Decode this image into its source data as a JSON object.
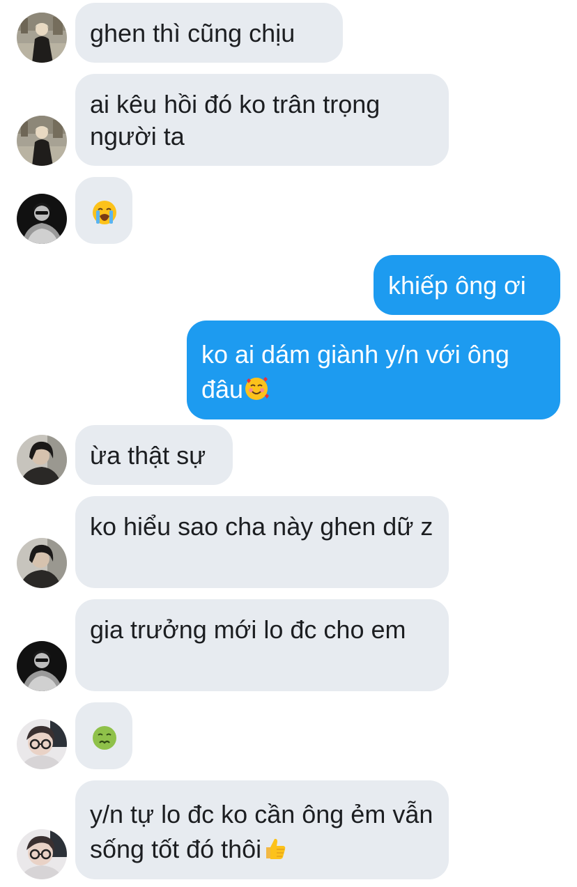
{
  "messages": [
    {
      "id": "m1",
      "direction": "incoming",
      "sender_avatar": "avatar-blond-coat",
      "text": "ghen thì cũng chịu",
      "emoji": ""
    },
    {
      "id": "m2",
      "direction": "incoming",
      "sender_avatar": "avatar-blond-coat",
      "text": "ai kêu hồi đó ko trân trọng người ta",
      "emoji": ""
    },
    {
      "id": "m3",
      "direction": "incoming",
      "sender_avatar": "avatar-bw-sunglasses",
      "text": "",
      "emoji": "loudly-crying-face"
    },
    {
      "id": "m4",
      "direction": "outgoing",
      "text": "khiếp ông ơi",
      "emoji": ""
    },
    {
      "id": "m5",
      "direction": "outgoing",
      "text": "ko ai dám giành y/n với ông đâu",
      "emoji": "smiling-face-with-hearts"
    },
    {
      "id": "m6",
      "direction": "incoming",
      "sender_avatar": "avatar-dark-hair",
      "text": "ừa thật sự",
      "emoji": ""
    },
    {
      "id": "m7",
      "direction": "incoming",
      "sender_avatar": "avatar-dark-hair",
      "text": "ko hiểu sao cha này ghen dữ z",
      "emoji": ""
    },
    {
      "id": "m8",
      "direction": "incoming",
      "sender_avatar": "avatar-bw-sunglasses",
      "text": "gia trưởng mới lo đc cho em",
      "emoji": ""
    },
    {
      "id": "m9",
      "direction": "incoming",
      "sender_avatar": "avatar-glasses",
      "text": "",
      "emoji": "nauseated-face"
    },
    {
      "id": "m10",
      "direction": "incoming",
      "sender_avatar": "avatar-glasses",
      "text": "y/n tự lo đc ko cần ông ẻm vẫn sống tốt đó thôi",
      "emoji": "thumbs-up"
    }
  ],
  "colors": {
    "incoming_bubble": "#e7ebf0",
    "outgoing_bubble": "#1d9bf0",
    "incoming_text": "#1c1e21",
    "outgoing_text": "#ffffff"
  }
}
